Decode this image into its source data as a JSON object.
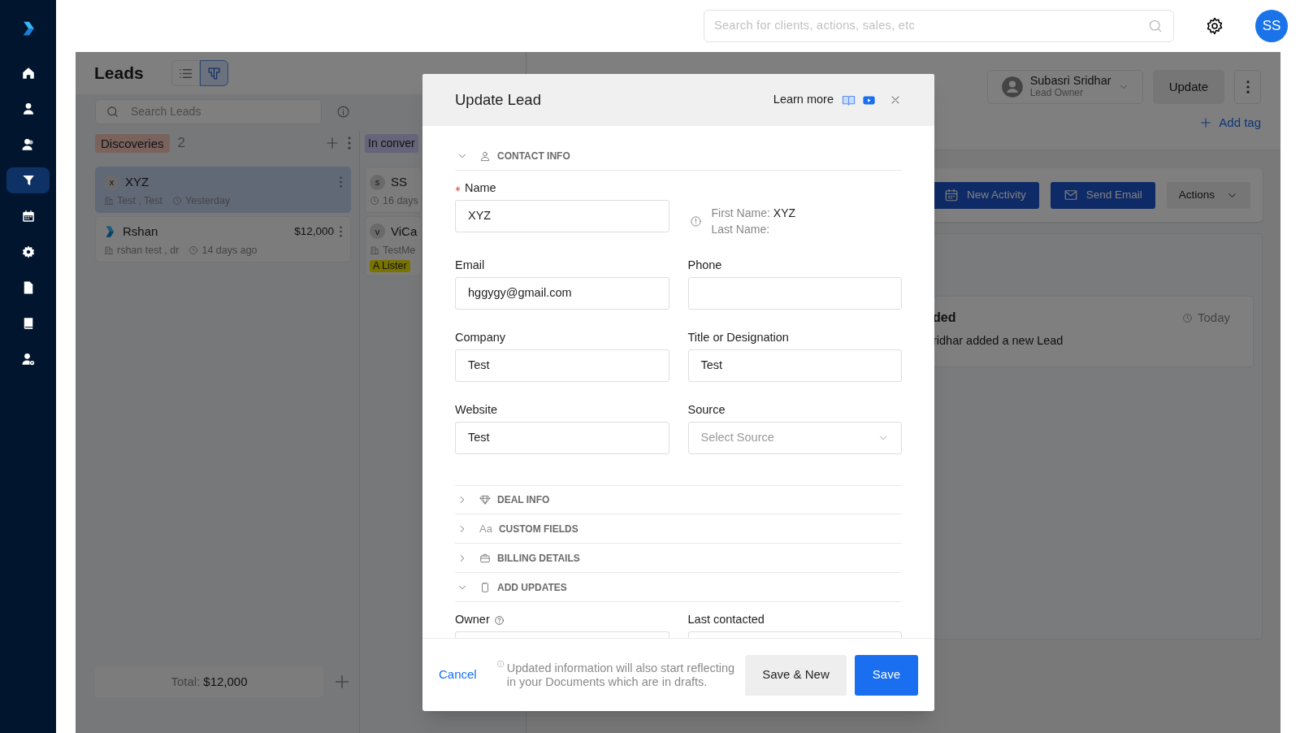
{
  "sidebar": {
    "items": [
      {
        "kind": "home",
        "selected": false
      },
      {
        "kind": "user",
        "selected": false
      },
      {
        "kind": "users",
        "selected": false
      },
      {
        "kind": "funnel",
        "selected": true
      },
      {
        "kind": "calendar",
        "selected": false
      },
      {
        "kind": "gear",
        "selected": false
      },
      {
        "kind": "document",
        "selected": false
      },
      {
        "kind": "book",
        "selected": false
      },
      {
        "kind": "user_gear",
        "selected": false
      }
    ]
  },
  "top_bar": {
    "search": {
      "placeholder": "Search for clients, actions, sales, etc"
    },
    "avatar": "SS"
  },
  "leads_panel": {
    "title": "Leads",
    "views": [
      {
        "kind": "list",
        "selected": false
      },
      {
        "kind": "board",
        "selected": true
      }
    ],
    "search": {
      "placeholder": "Search Leads"
    },
    "columns": [
      {
        "name": "Discoveries",
        "color": "#7a625d",
        "count": "2",
        "cards": [
          {
            "avatar": "x",
            "name": "XYZ",
            "company": "Test , Test",
            "time": "Yesterday",
            "selected": true
          },
          {
            "name": "Rshan",
            "amount": "$12,000",
            "company": "rshan test , dr",
            "time": "14 days ago",
            "selected": false
          }
        ],
        "total_label": "Total:",
        "total": "$12,000"
      },
      {
        "name": "In conver",
        "color": "#64647a",
        "cards": [
          {
            "avatar": "s",
            "name": "SS",
            "time": "16 days",
            "selected": false
          },
          {
            "avatar": "v",
            "name": "ViCa",
            "company": "TestMe",
            "tag": "A Lister",
            "selected": false
          }
        ]
      }
    ]
  },
  "detail_panel": {
    "owner": {
      "name": "Subasri Sridhar",
      "role": "Lead Owner"
    },
    "update_button": "Update",
    "add_tag": "Add tag",
    "actions": [
      {
        "label": "New Activity",
        "kind": "activity"
      },
      {
        "label": "Send Email",
        "kind": "email"
      },
      {
        "label": "Actions",
        "kind": "menu"
      }
    ],
    "activity": {
      "title": "ded",
      "time": "Today",
      "text": "ridhar added a new Lead"
    }
  },
  "modal": {
    "title": "Update Lead",
    "learn_more": "Learn more",
    "sections": [
      {
        "label": "CONTACT INFO",
        "kind": "contact",
        "expanded": true,
        "fields": [
          {
            "label": "Name",
            "kind": "text",
            "value": "XYZ",
            "required": true,
            "help": false
          },
          {
            "kind": "info",
            "first_label": "First Name:",
            "first": "XYZ",
            "last_label": "Last Name:"
          },
          {
            "label": "Email",
            "kind": "text",
            "value": "hggygy@gmail.com",
            "required": false,
            "help": false
          },
          {
            "label": "Phone",
            "kind": "text",
            "required": false,
            "help": false
          },
          {
            "label": "Company",
            "kind": "text",
            "value": "Test",
            "required": false,
            "help": false
          },
          {
            "label": "Title or Designation",
            "kind": "text",
            "value": "Test",
            "required": false,
            "help": false
          },
          {
            "label": "Website",
            "kind": "text",
            "value": "Test",
            "required": false,
            "help": false
          },
          {
            "label": "Source",
            "kind": "select",
            "placeholder": "Select Source",
            "required": false,
            "help": false
          }
        ]
      },
      {
        "label": "DEAL INFO",
        "kind": "deal",
        "expanded": false
      },
      {
        "label": "CUSTOM FIELDS",
        "icon_text": "Aa",
        "expanded": false
      },
      {
        "label": "BILLING DETAILS",
        "kind": "billing",
        "expanded": false
      },
      {
        "label": "ADD UPDATES",
        "kind": "updates",
        "expanded": true,
        "fields": [
          {
            "label": "Owner",
            "kind": "text",
            "required": false,
            "help": true
          },
          {
            "label": "Last contacted",
            "kind": "date",
            "required": false,
            "help": false
          }
        ]
      }
    ],
    "footer": {
      "cancel": "Cancel",
      "note": "Updated information will also start reflecting in your Documents which are in drafts.",
      "buttons": [
        {
          "label": "Save & New",
          "kind": "secondary"
        },
        {
          "label": "Save",
          "kind": "primary"
        }
      ]
    }
  }
}
